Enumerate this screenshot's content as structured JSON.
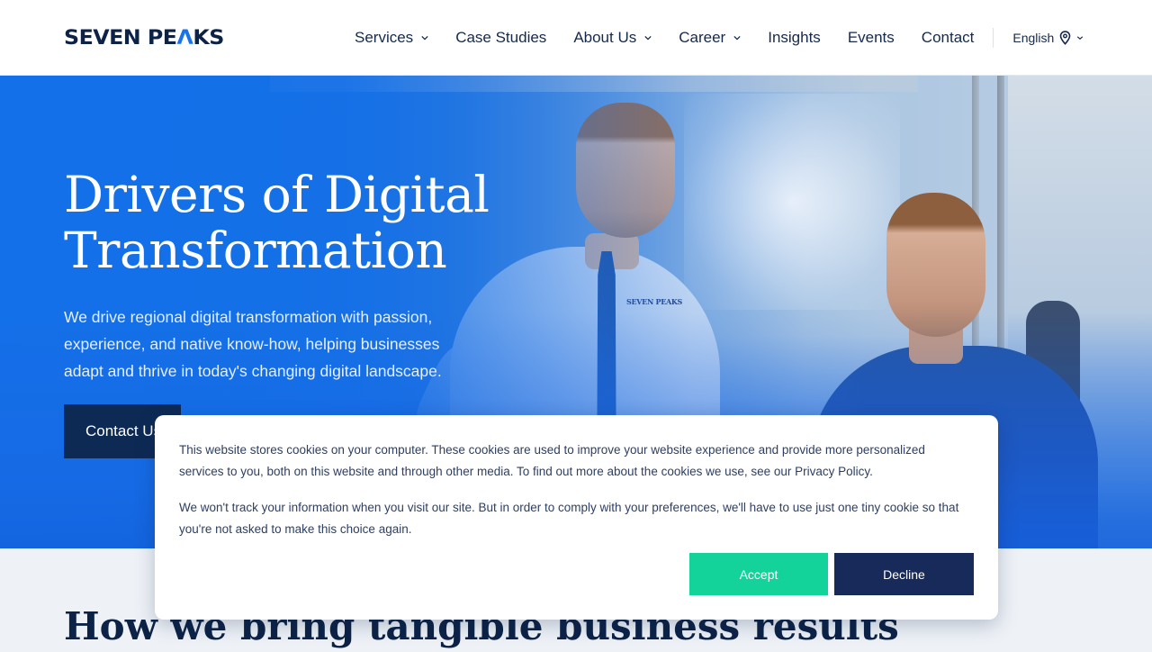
{
  "header": {
    "logo": {
      "part1": "SEVEN",
      "part2": "PE",
      "accent": "Λ",
      "part3": "KS"
    },
    "nav": [
      {
        "label": "Services",
        "has_dropdown": true
      },
      {
        "label": "Case Studies",
        "has_dropdown": false
      },
      {
        "label": "About Us",
        "has_dropdown": true
      },
      {
        "label": "Career",
        "has_dropdown": true
      },
      {
        "label": "Insights",
        "has_dropdown": false
      },
      {
        "label": "Events",
        "has_dropdown": false
      },
      {
        "label": "Contact",
        "has_dropdown": false
      }
    ],
    "language": {
      "label": "English",
      "icon": "location-pin-icon"
    }
  },
  "hero": {
    "title_line1": "Drivers of Digital",
    "title_line2": "Transformation",
    "description": "We drive regional digital transformation with passion, experience, and native know-how, helping businesses adapt and thrive in today's changing digital landscape.",
    "cta_label": "Contact Us",
    "shirt_logo": "SEVEN PEAKS"
  },
  "section": {
    "title": "How we bring tangible business results"
  },
  "cookie_banner": {
    "paragraph1": "This website stores cookies on your computer. These cookies are used to improve your website experience and provide more personalized services to you, both on this website and through other media. To find out more about the cookies we use, see our Privacy Policy.",
    "paragraph2": "We won't track your information when you visit our site. But in order to comply with your preferences, we'll have to use just one tiny cookie so that you're not asked to make this choice again.",
    "accept_label": "Accept",
    "decline_label": "Decline"
  },
  "colors": {
    "brand_navy": "#0c2347",
    "brand_blue": "#1470e8",
    "accept_green": "#13d39a",
    "decline_navy": "#172a5a"
  }
}
